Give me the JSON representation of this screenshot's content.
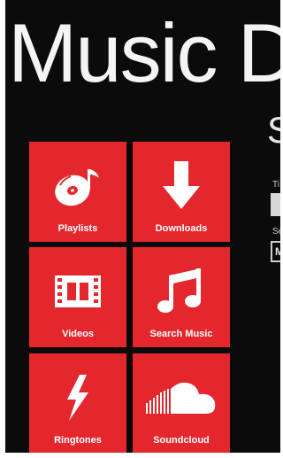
{
  "app": {
    "title": "Music D",
    "section_title": "S"
  },
  "peek": {
    "label_1": "Ti",
    "label_2": "Se",
    "select_value": "M"
  },
  "tiles": [
    {
      "label": "Playlists",
      "icon": "disc-music-icon"
    },
    {
      "label": "Downloads",
      "icon": "download-arrow-icon"
    },
    {
      "label": "Videos",
      "icon": "film-strip-icon"
    },
    {
      "label": "Search Music",
      "icon": "music-note-icon"
    },
    {
      "label": "Ringtones",
      "icon": "lightning-icon"
    },
    {
      "label": "Soundcloud",
      "icon": "soundcloud-icon"
    }
  ],
  "colors": {
    "background": "#0b0b0b",
    "tile": "#e3272d",
    "text": "#ffffff"
  }
}
